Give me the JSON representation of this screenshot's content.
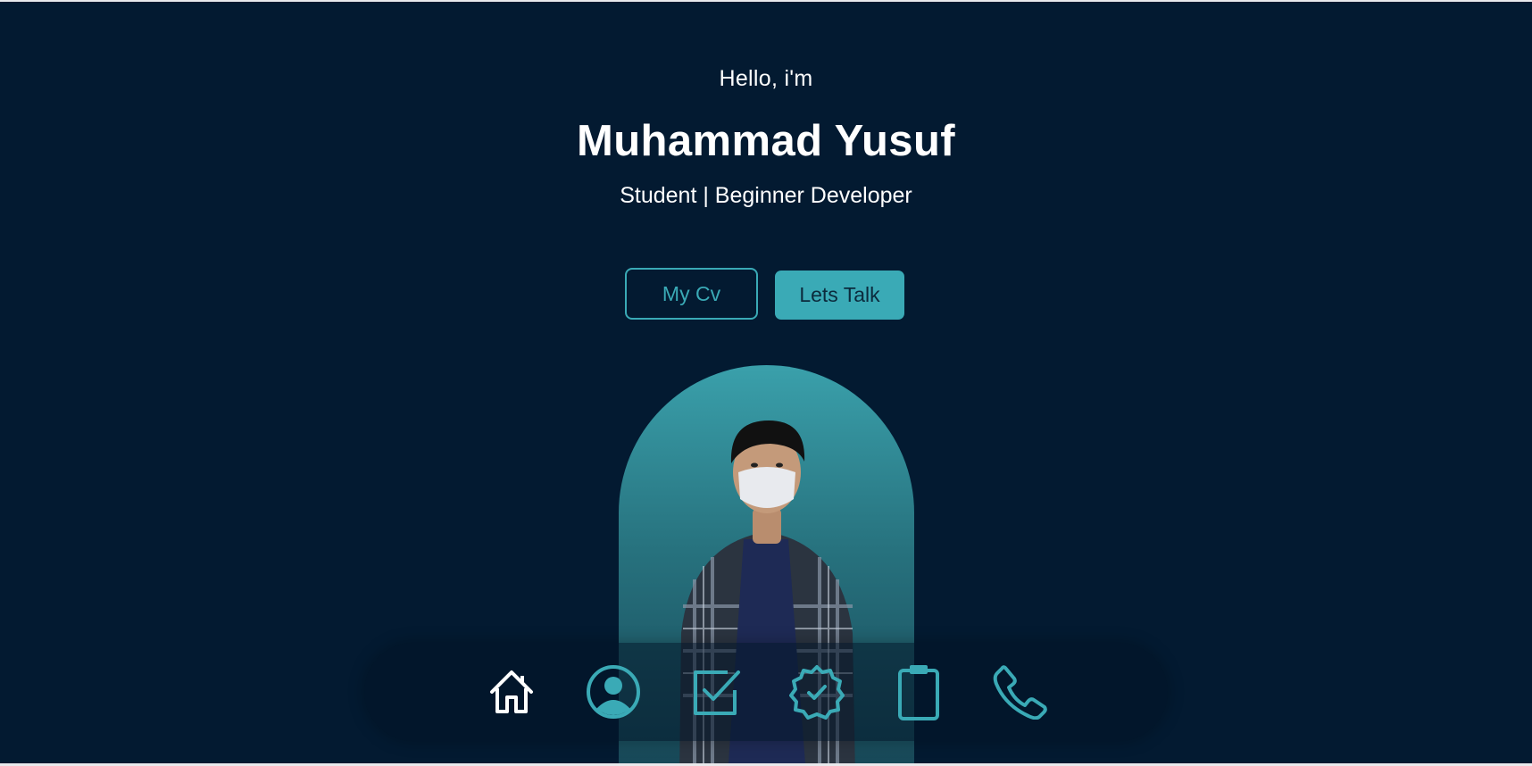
{
  "hero": {
    "greeting": "Hello, i'm",
    "name": "Muhammad Yusuf",
    "subtitle": "Student | Beginner Developer"
  },
  "actions": {
    "cv_label": "My Cv",
    "talk_label": "Lets Talk"
  },
  "nav": {
    "items": [
      {
        "icon": "home-icon",
        "active": true
      },
      {
        "icon": "user-circle-icon",
        "active": false
      },
      {
        "icon": "checkbox-icon",
        "active": false
      },
      {
        "icon": "badge-check-icon",
        "active": false
      },
      {
        "icon": "clipboard-icon",
        "active": false
      },
      {
        "icon": "phone-icon",
        "active": false
      }
    ]
  },
  "colors": {
    "background": "#031a31",
    "accent": "#3aaab6",
    "text": "#ffffff"
  }
}
